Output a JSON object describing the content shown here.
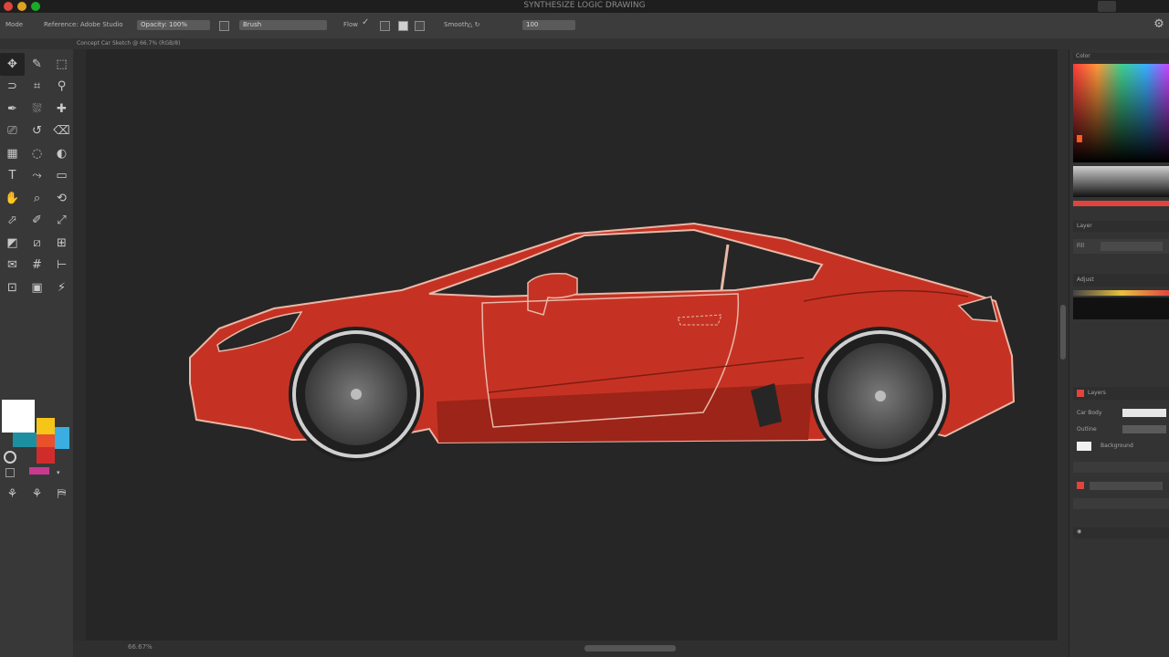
{
  "window": {
    "title": "SYNTHESIZE LOGIC DRAWING",
    "traffic_colors": [
      "#e0443e",
      "#dea123",
      "#1aab29"
    ]
  },
  "options_bar": {
    "items": [
      {
        "label": "Mode"
      },
      {
        "label": "Reference: Adobe Studio"
      },
      {
        "value": "Opacity: 100%"
      },
      {
        "value": "Brush"
      },
      {
        "label": "Flow"
      },
      {
        "label": "Smooth"
      },
      {
        "value": "100"
      }
    ]
  },
  "document": {
    "tab": "Concept Car Sketch @ 66.7% (RGB/8)",
    "zoom": "66.67%"
  },
  "tools": [
    "move",
    "brush",
    "marquee",
    "lasso",
    "crop",
    "eyedropper",
    "pen",
    "paint",
    "heal",
    "stamp",
    "history",
    "eraser",
    "gradient",
    "blur",
    "dodge",
    "text",
    "path",
    "shape",
    "hand",
    "zoom",
    "rotate",
    "select",
    "edit",
    "transform",
    "mask",
    "slice",
    "grid",
    "note",
    "count",
    "ruler",
    "frame",
    "artboard",
    "quick"
  ],
  "swatches": {
    "colors": [
      "#ffffff",
      "#f5c518",
      "#e8512b",
      "#1e8fa0",
      "#d02c2c",
      "#3aaee0",
      "#c93a8e"
    ]
  },
  "panels": {
    "color": {
      "label": "Color"
    },
    "properties": {
      "rows": [
        "Layer",
        "Fill"
      ]
    },
    "adjustments": {
      "label": "Adjust"
    },
    "layers": {
      "header": "Layers",
      "rows": [
        {
          "name": "Car Body",
          "color": "#ffffff"
        },
        {
          "name": "Outline",
          "color": "#e0443e"
        },
        {
          "name": "Background",
          "color": "#3a3a3a"
        }
      ]
    }
  },
  "car": {
    "body_color": "#c53223",
    "shadow_color": "#9c2418",
    "outline_color": "#e8b8a8"
  }
}
